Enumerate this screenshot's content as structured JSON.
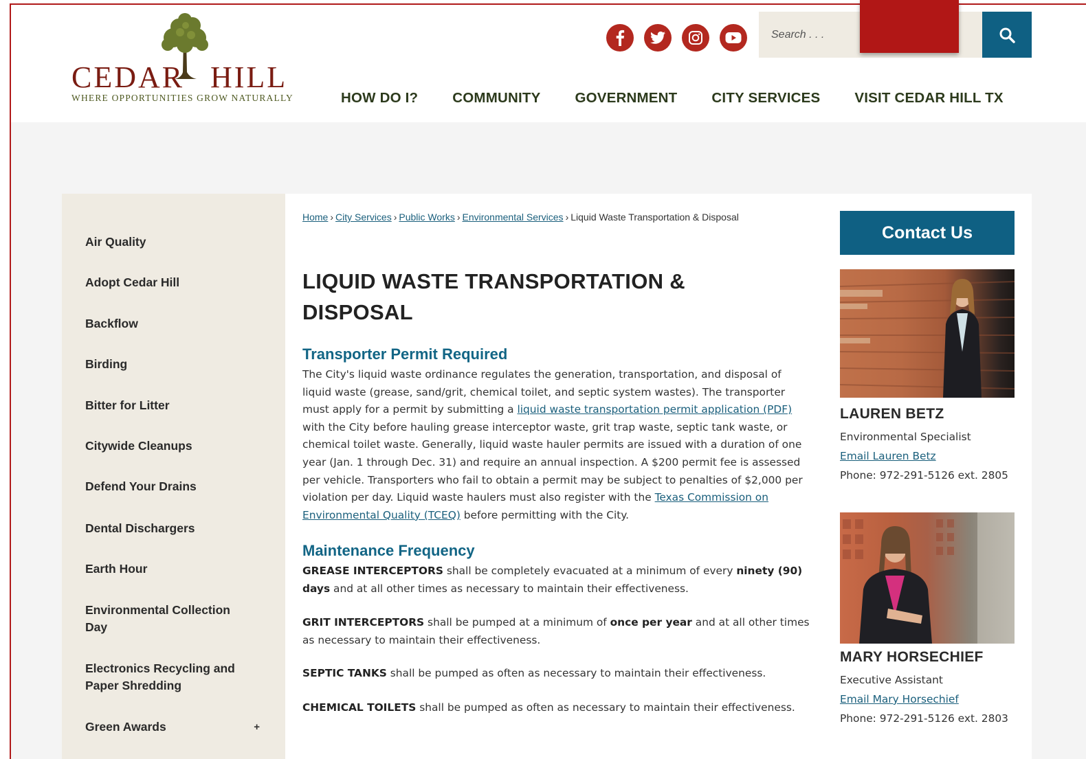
{
  "brand": {
    "name": "CEDAR HILL",
    "tagline": "Where Opportunities Grow Naturally",
    "accent": "#b3281f",
    "primary": "#0f6083"
  },
  "social": [
    {
      "name": "facebook-icon",
      "label": "f"
    },
    {
      "name": "twitter-icon",
      "label": "twitter"
    },
    {
      "name": "instagram-icon",
      "label": "instagram"
    },
    {
      "name": "youtube-icon",
      "label": "youtube"
    }
  ],
  "search": {
    "placeholder": "Search . . ."
  },
  "nav": [
    "HOW DO I?",
    "COMMUNITY",
    "GOVERNMENT",
    "CITY SERVICES",
    "VISIT CEDAR HILL TX"
  ],
  "sidebar": {
    "items": [
      "Air Quality",
      "Adopt Cedar Hill",
      "Backflow",
      "Birding",
      "Bitter for Litter",
      "Citywide Cleanups",
      "Defend Your Drains",
      "Dental Dischargers",
      "Earth Hour",
      "Environmental Collection Day",
      "Electronics Recycling and Paper Shredding",
      "Green Awards"
    ],
    "expand_symbol": "+"
  },
  "breadcrumb": {
    "links": [
      "Home",
      "City Services",
      "Public Works",
      "Environmental Services"
    ],
    "separator": "›",
    "current": "Liquid Waste Transportation & Disposal"
  },
  "page": {
    "title": "LIQUID WASTE TRANSPORTATION & DISPOSAL",
    "section1": {
      "heading": "Transporter Permit Required",
      "text_a": "The City's liquid waste ordinance regulates the generation, transportation, and disposal of liquid waste (grease, sand/grit, chemical toilet, and septic system wastes). The transporter must apply for a permit by submitting a ",
      "link_a": "liquid waste transportation permit application (PDF)",
      "text_b": " with the City before hauling grease interceptor waste, grit trap waste, septic tank waste, or chemical toilet waste. Generally, liquid waste hauler permits are issued with a duration of one year (Jan. 1 through Dec. 31) and require an annual inspection. A $200 permit fee is assessed per vehicle. Transporters who fail to obtain a permit may be subject to penalties of $2,000 per violation per day. Liquid waste haulers must also register with the ",
      "link_b": "Texas Commission on Environmental Quality (TCEQ)",
      "text_c": " before permitting with the City."
    },
    "section2": {
      "heading": "Maintenance Frequency",
      "grease_label": "GREASE INTERCEPTORS",
      "grease_text_a": " shall be completely evacuated at a minimum of every ",
      "grease_bold": "ninety (90) days",
      "grease_text_b": " and at all other times as necessary to maintain their effectiveness.",
      "grit_label": "GRIT INTERCEPTORS",
      "grit_text_a": " shall be pumped at a minimum of ",
      "grit_bold": "once per year",
      "grit_text_b": " and at all other times as necessary to maintain their effectiveness.",
      "septic_label": "SEPTIC TANKS",
      "septic_text": " shall be pumped as often as necessary to maintain their effectiveness.",
      "chem_label": "CHEMICAL TOILETS",
      "chem_text": " shall be pumped as often as necessary to maintain their effectiveness."
    }
  },
  "contact": {
    "button": "Contact Us",
    "people": [
      {
        "name": "LAUREN BETZ",
        "role": "Environmental Specialist",
        "email": "Email Lauren Betz",
        "phone": "Phone: 972-291-5126 ext. 2805"
      },
      {
        "name": "MARY HORSECHIEF",
        "role": "Executive Assistant",
        "email": "Email Mary Horsechief",
        "phone": "Phone: 972-291-5126 ext. 2803"
      }
    ]
  }
}
